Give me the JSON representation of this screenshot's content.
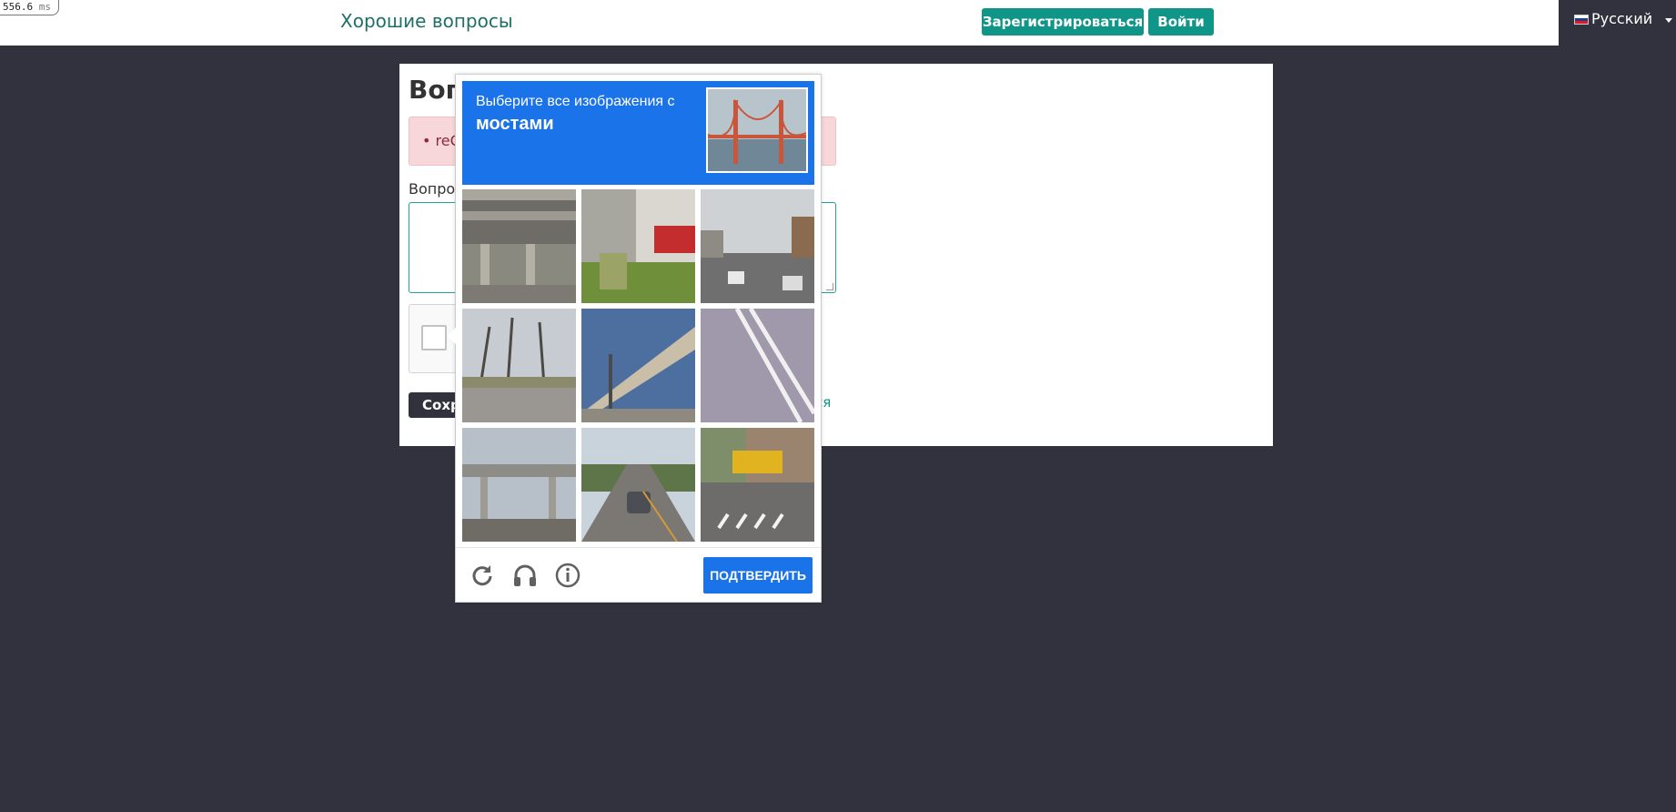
{
  "timer": {
    "value": "556.6",
    "unit": "ms"
  },
  "header": {
    "brand": "Хорошие вопросы",
    "register_label": "Зарегистрироваться",
    "login_label": "Войти",
    "language_label": "Русский"
  },
  "form": {
    "title": "Воп",
    "alert_text": "• reCA",
    "question_label": "Вопрос",
    "save_label": "Сохр",
    "cancel_label": "ся"
  },
  "challenge": {
    "instruction": "Выберите все изображения с",
    "target": "мостами",
    "verify_label": "ПОДТВЕРДИТЬ",
    "icons": [
      "reload-icon",
      "headphones-icon",
      "info-icon"
    ],
    "tiles": [
      "overpass-underside",
      "yard-with-red-car",
      "street-with-traffic",
      "bare-trees-road",
      "highway-overpass",
      "road-lines",
      "overpass-street",
      "car-on-road",
      "school-bus-crosswalk"
    ]
  },
  "colors": {
    "background": "#31323d",
    "teal": "#0f9688",
    "brand": "#1f6f66",
    "challenge_blue": "#1a73e8"
  }
}
